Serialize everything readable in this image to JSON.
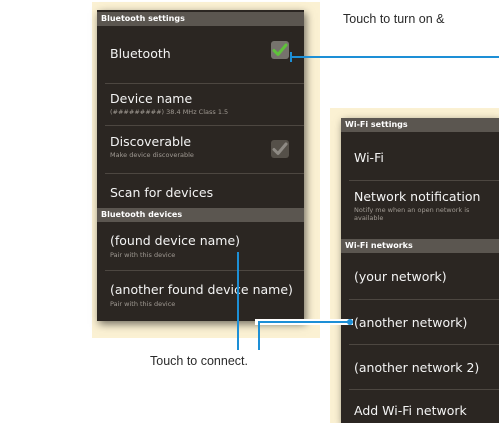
{
  "bluetooth_panel": {
    "section_title": "Bluetooth settings",
    "bluetooth": {
      "label": "Bluetooth",
      "checked": true
    },
    "device_name": {
      "label": "Device name",
      "sub": "(#########) 38.4 MHz Class 1.5"
    },
    "discoverable": {
      "label": "Discoverable",
      "sub": "Make device discoverable",
      "checked": false
    },
    "scan": {
      "label": "Scan for devices"
    },
    "devices_title": "Bluetooth devices",
    "devices": [
      {
        "label": "(found device name)",
        "sub": "Pair with this device"
      },
      {
        "label": "(another found device name)",
        "sub": "Pair with this device"
      }
    ]
  },
  "wifi_panel": {
    "section_title": "Wi-Fi settings",
    "wifi": {
      "label": "Wi-Fi"
    },
    "notification": {
      "label": "Network notification",
      "sub_line1": "Notify me when an open network is",
      "sub_line2": "available"
    },
    "networks_title": "Wi-Fi networks",
    "networks": [
      {
        "label": "(your network)"
      },
      {
        "label": "(another network)"
      },
      {
        "label": "(another network 2)"
      }
    ],
    "add": {
      "label": "Add Wi-Fi network"
    }
  },
  "callouts": {
    "turn_on": "Touch to turn on &",
    "connect": "Touch to connect."
  },
  "colors": {
    "panel_bg": "#2b2622",
    "section_header": "#5b5650",
    "halo": "#fbf1d3",
    "callout_line": "#1d8fd6",
    "check_green": "#5fc23b"
  }
}
